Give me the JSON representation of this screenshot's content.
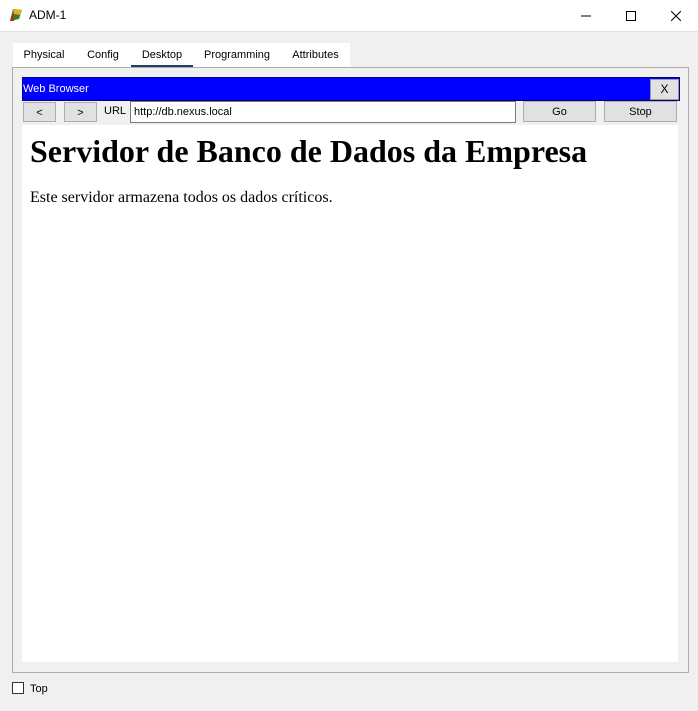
{
  "window": {
    "title": "ADM-1",
    "app_icon": "packet-tracer-icon",
    "controls": [
      "minimize-icon",
      "maximize-icon",
      "close-icon"
    ]
  },
  "tabs": [
    {
      "label": "Physical",
      "active": false
    },
    {
      "label": "Config",
      "active": false
    },
    {
      "label": "Desktop",
      "active": true
    },
    {
      "label": "Programming",
      "active": false
    },
    {
      "label": "Attributes",
      "active": false
    }
  ],
  "browser": {
    "title": "Web Browser",
    "close_label": "X",
    "back_label": "<",
    "forward_label": ">",
    "url_label": "URL",
    "url_value": "http://db.nexus.local",
    "go_label": "Go",
    "stop_label": "Stop",
    "header_color": "#0000ff"
  },
  "page": {
    "heading": "Servidor de Banco de Dados da Empresa",
    "paragraph": "Este servidor armazena todos os dados críticos."
  },
  "footer": {
    "top_label": "Top",
    "top_checked": false
  }
}
